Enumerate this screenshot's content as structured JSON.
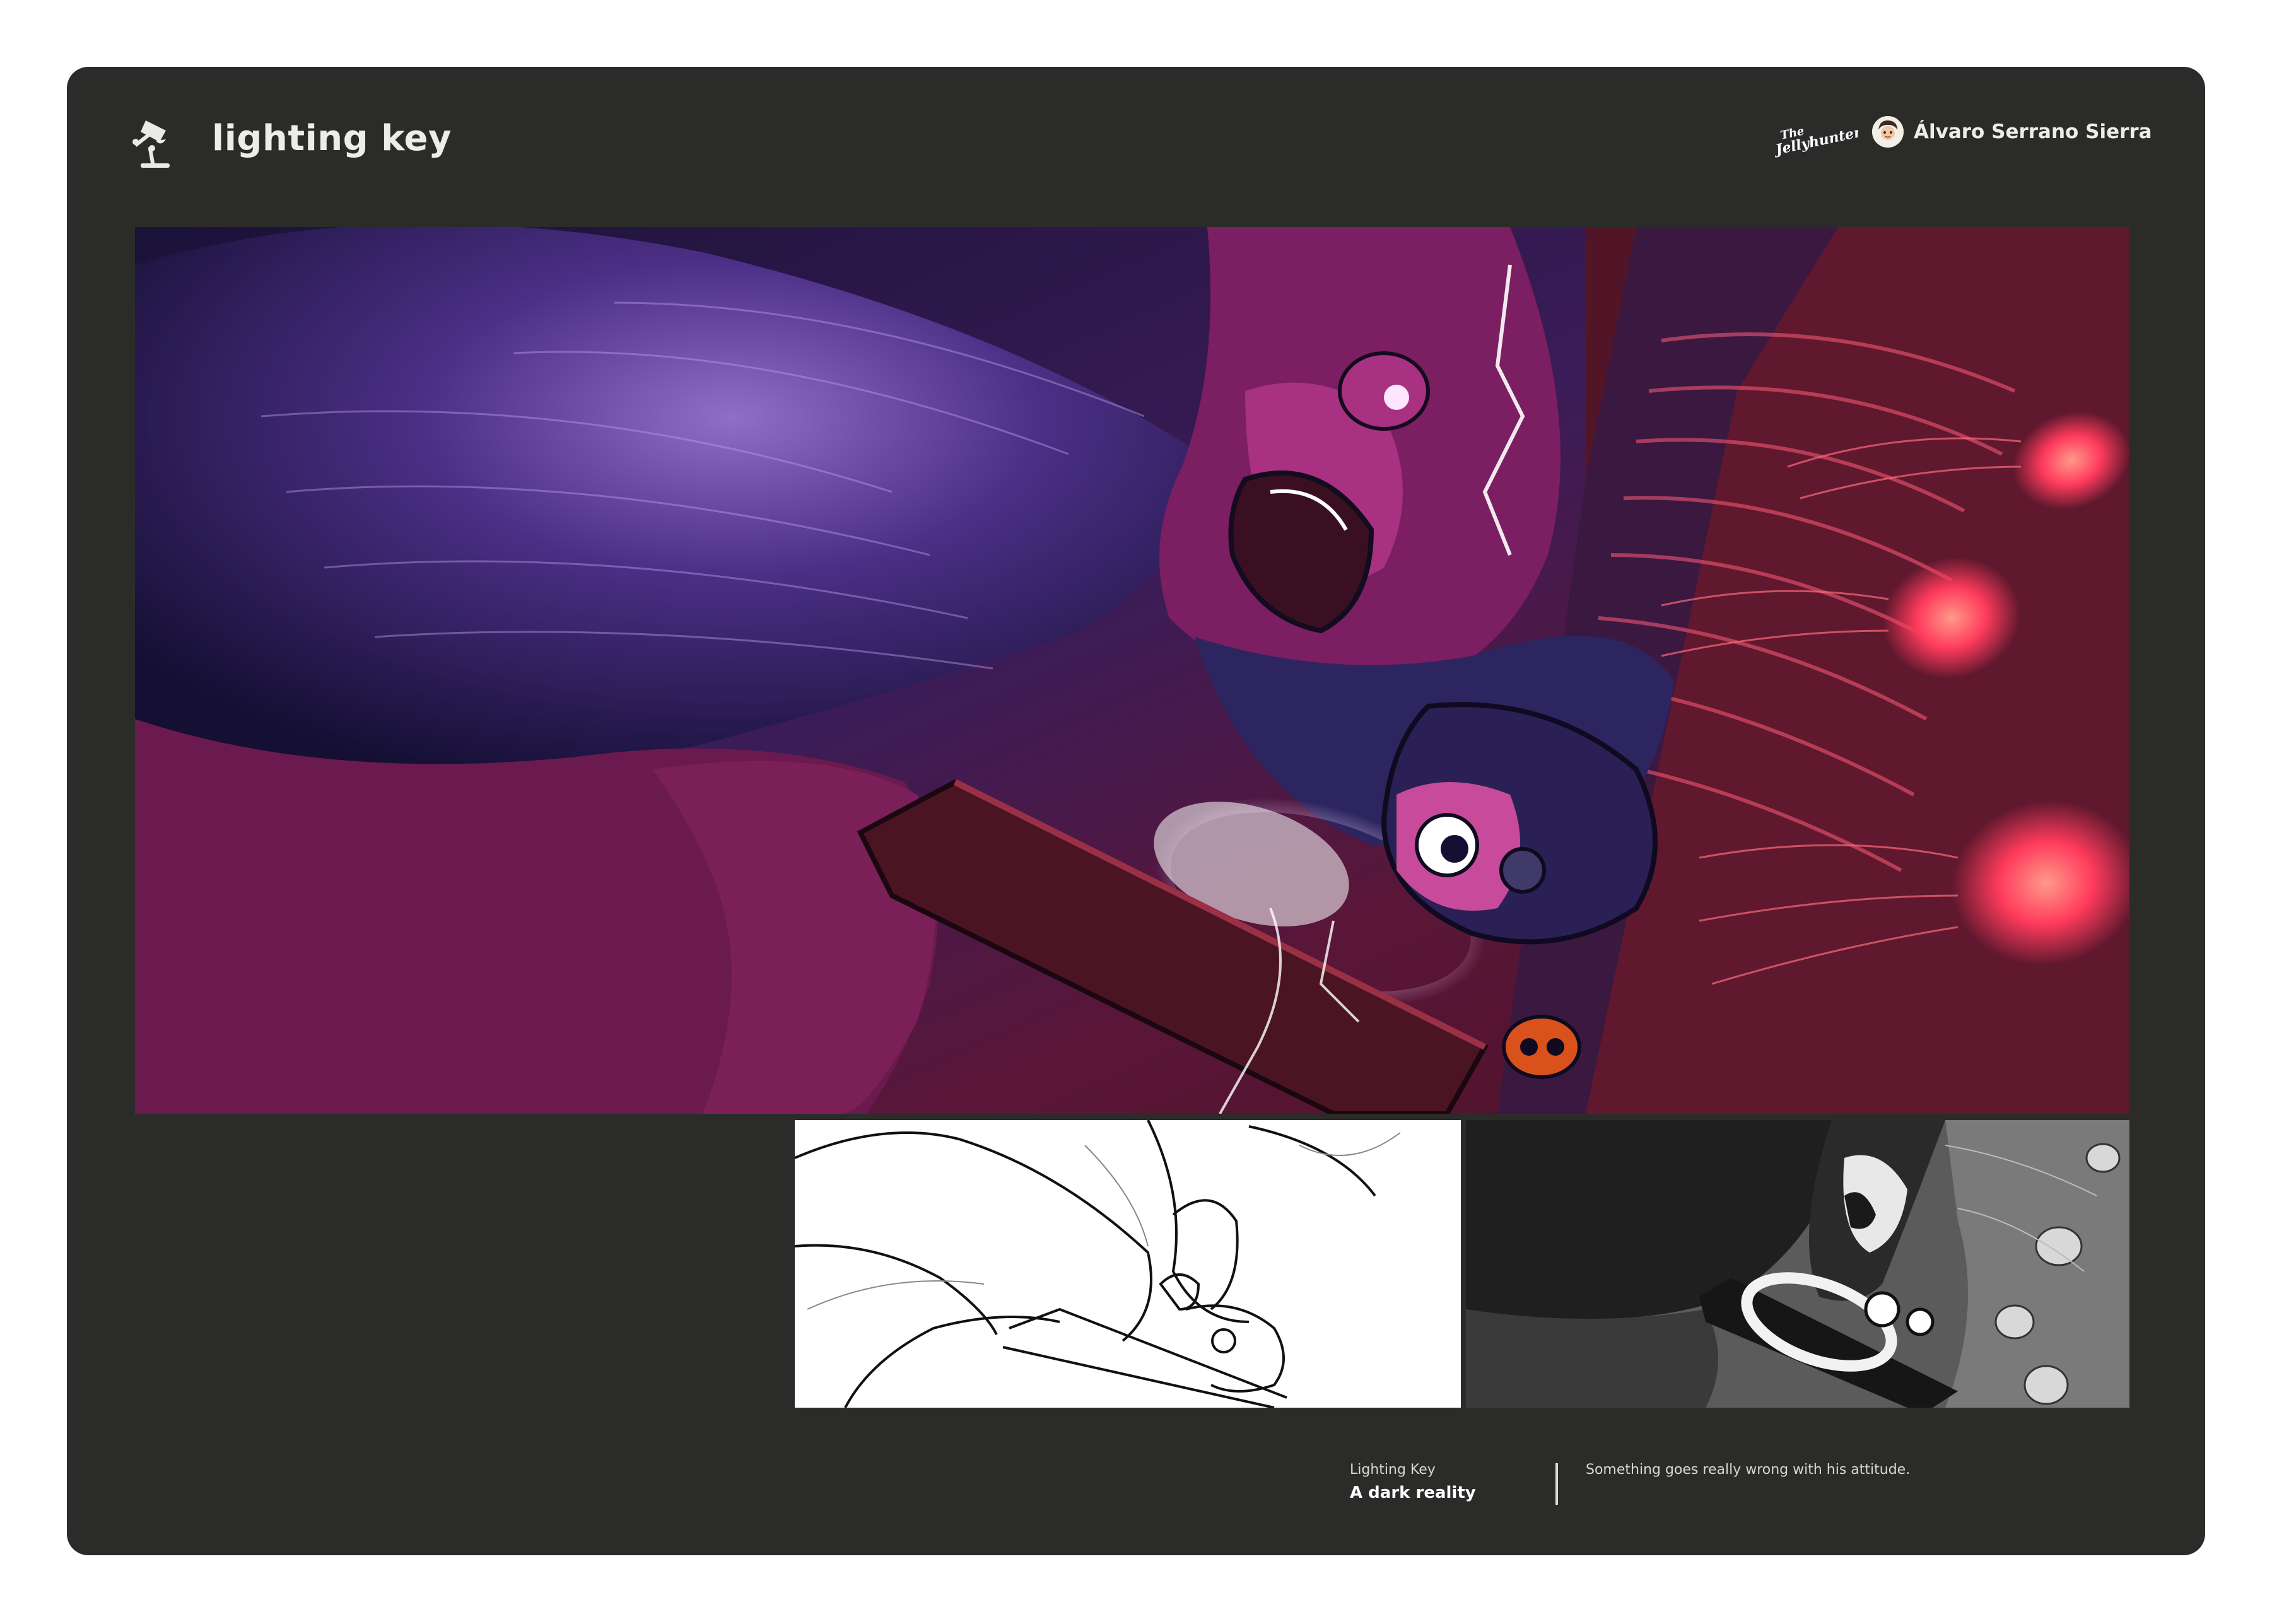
{
  "header": {
    "title": "lighting key",
    "icon": "desk-lamp-icon",
    "brand_logo_text": "The Jellyhunters",
    "author": "Álvaro Serrano Sierra"
  },
  "caption": {
    "kicker": "Lighting Key",
    "title": "A dark reality",
    "description": "Something goes really wrong with his attitude."
  },
  "colors": {
    "card_background": "#2b2c2a",
    "page_background": "#ffffff",
    "art_deep_purple": "#2a1746",
    "art_magenta": "#6c1a4f",
    "art_jellyfish_red": "#ff3b5c"
  }
}
